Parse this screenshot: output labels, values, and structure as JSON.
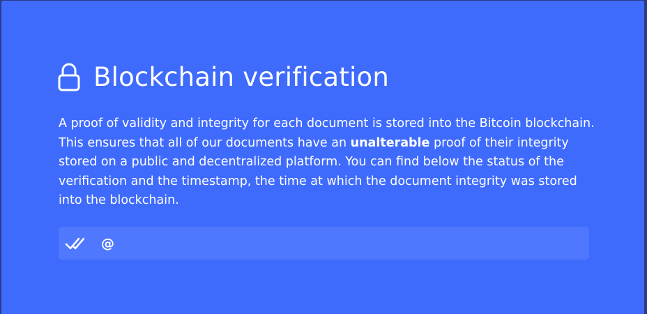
{
  "header": {
    "icon": "lock-icon",
    "title": "Blockchain verification"
  },
  "description": {
    "part1": "A proof of validity and integrity for each document is stored into the Bitcoin blockchain. This ensures that all of our documents have an ",
    "emphasis": "unalterable",
    "part2": " proof of their integrity stored on a public and decentralized platform. You can find below the status of the verification and the timestamp, the time at which the document integrity was stored into the blockchain."
  },
  "status": {
    "icon": "double-check-icon",
    "text": "@"
  },
  "colors": {
    "panel_background": "#3f6bfd",
    "status_background": "#4f78ff",
    "text": "#ffffff"
  }
}
